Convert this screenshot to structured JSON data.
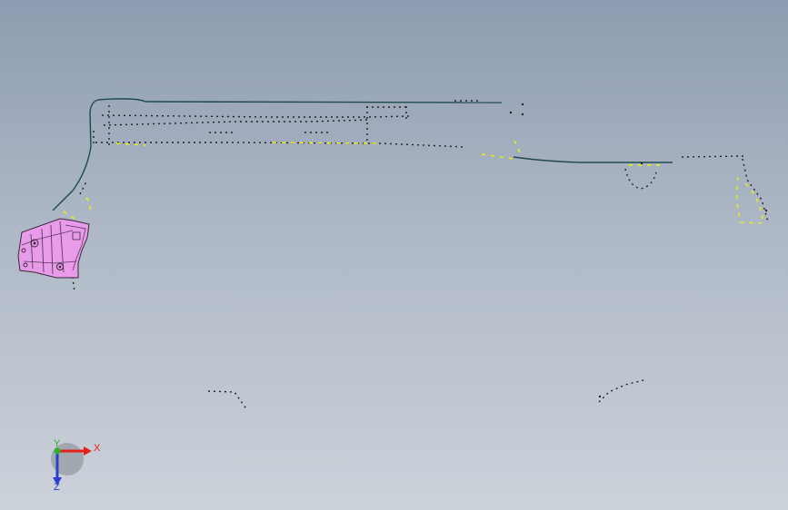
{
  "viewport": {
    "background_top": "#8d9cb0",
    "background_bottom": "#ccd2da"
  },
  "model": {
    "edge_color": "#1f4a4a",
    "dotted_edge_color": "#222222",
    "highlight_color": "#f2f200",
    "part_color": "#e79be9",
    "part_edge_color": "#3a2a3a"
  },
  "triad": {
    "x_label": "X",
    "y_label": "Y",
    "z_label": "Z",
    "x_color": "#e8201c",
    "y_color": "#2bb32b",
    "z_color": "#2a3fd1"
  }
}
